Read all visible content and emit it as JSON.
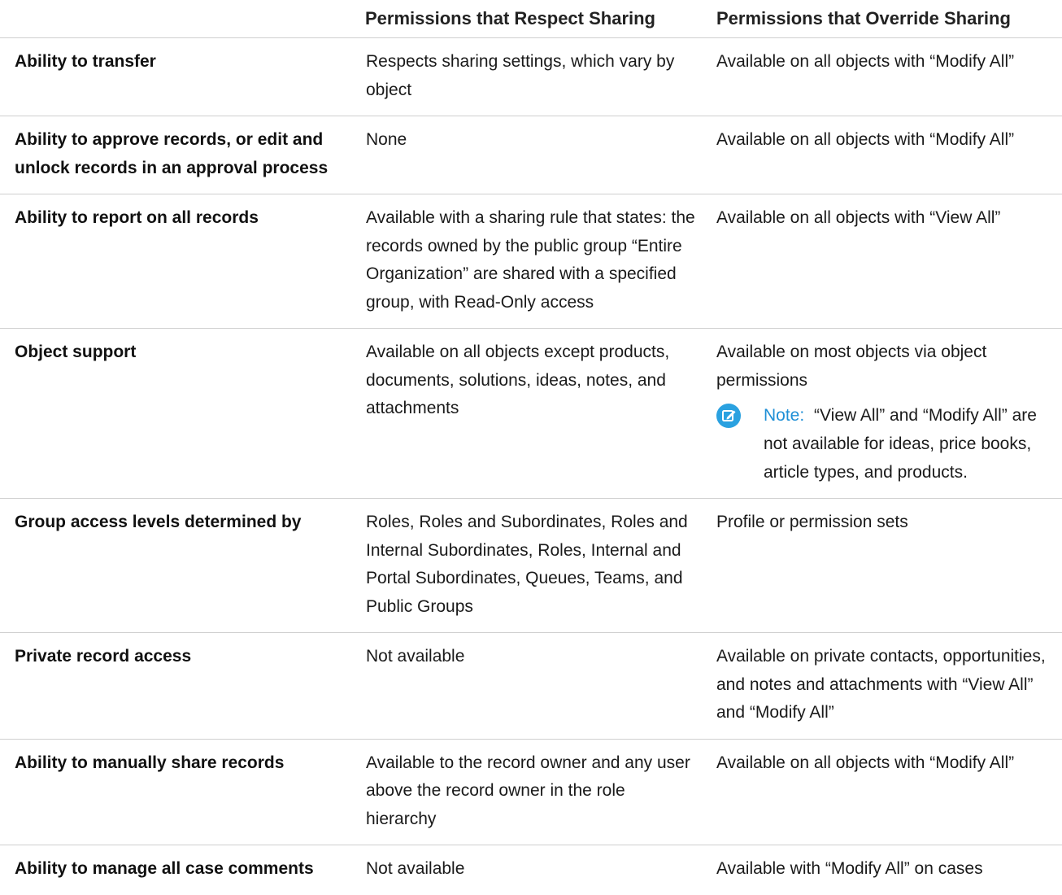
{
  "table": {
    "headers": [
      "",
      "Permissions that Respect Sharing",
      "Permissions that Override Sharing"
    ],
    "rows": [
      {
        "feature": "Ability to transfer",
        "respect": "Respects sharing settings, which vary by object",
        "override": "Available on all objects with “Modify All”"
      },
      {
        "feature": "Ability to approve records, or edit and unlock records in an approval process",
        "respect": "None",
        "override": "Available on all objects with “Modify All”"
      },
      {
        "feature": "Ability to report on all records",
        "respect": "Available with a sharing rule that states: the records owned by the public group “Entire Organization” are shared with a specified group, with Read-Only access",
        "override": "Available on all objects with “View All”"
      },
      {
        "feature": "Object support",
        "respect": "Available on all objects except products, documents, solutions, ideas, notes, and attachments",
        "override": "Available on most objects via object permissions",
        "note_label": "Note:",
        "note_text": "“View All” and “Modify All” are not available for ideas, price books, article types, and products."
      },
      {
        "feature": "Group access levels determined by",
        "respect": "Roles, Roles and Subordinates, Roles and Internal Subordinates, Roles, Internal and Portal Subordinates, Queues, Teams, and Public Groups",
        "override": "Profile or permission sets"
      },
      {
        "feature": "Private record access",
        "respect": "Not available",
        "override": "Available on private contacts, opportunities, and notes and attachments with “View All” and “Modify All”"
      },
      {
        "feature": "Ability to manually share records",
        "respect": "Available to the record owner and any user above the record owner in the role hierarchy",
        "override": "Available on all objects with “Modify All”"
      },
      {
        "feature": "Ability to manage all case comments",
        "respect": "Not available",
        "override": "Available with “Modify All” on cases"
      }
    ]
  },
  "icons": {
    "note": "edit-note-icon"
  },
  "colors": {
    "note_accent": "#1f8fd6",
    "note_icon_bg": "#2aa1e0",
    "divider": "#cfcfcf"
  }
}
